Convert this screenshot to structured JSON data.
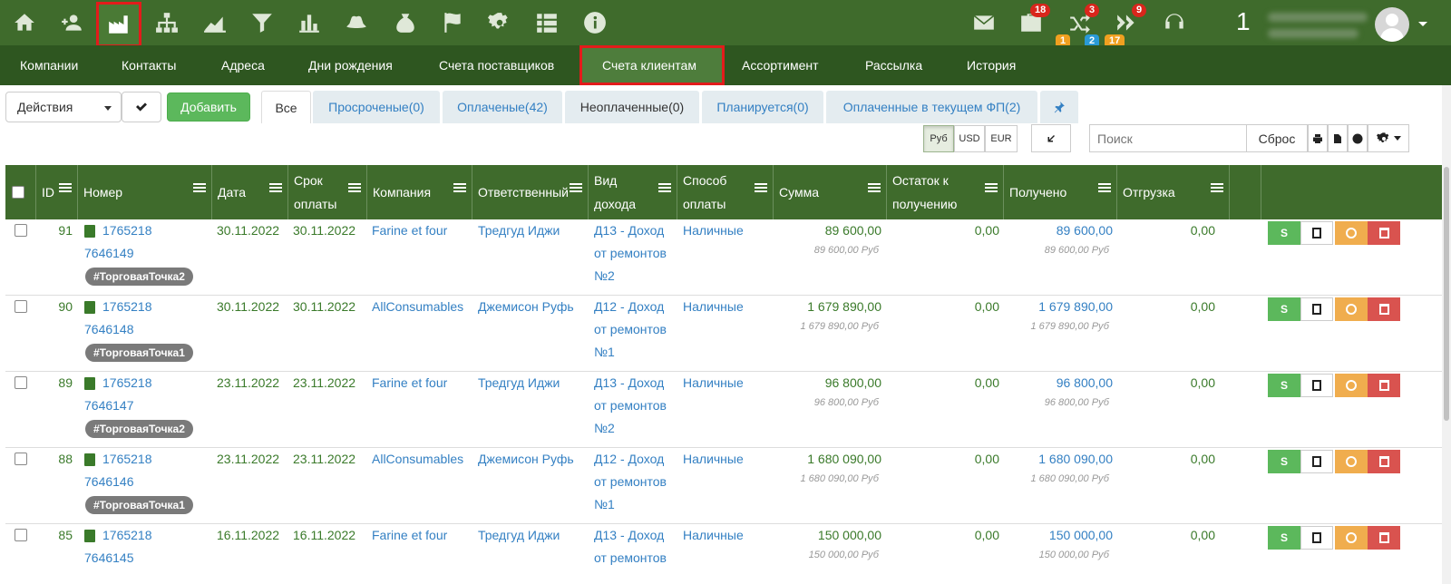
{
  "topbar": {
    "icons": [
      "home-icon",
      "contacts-icon",
      "factory-icon",
      "sitemap-icon",
      "area-chart-icon",
      "filter-icon",
      "bar-chart-icon",
      "hat-icon",
      "money-bag-icon",
      "flag-icon",
      "gear-icon",
      "list-icon",
      "info-icon"
    ],
    "mail_icon": "mail-icon",
    "briefcase_badge": "18",
    "shuffle_badge": "3",
    "shuffle_badge_orange": "1",
    "shuffle_badge_blue": "2",
    "forward_badge": "9",
    "forward_badge_orange": "17",
    "user_count": "1"
  },
  "nav": {
    "items": [
      "Компании",
      "Контакты",
      "Адреса",
      "Дни рождения",
      "Счета поставщиков",
      "Счета клиентам",
      "Ассортимент",
      "Рассылка",
      "История"
    ],
    "active": "Счета клиентам"
  },
  "toolbar": {
    "actions_label": "Действия",
    "add_label": "Добавить",
    "tabs": [
      "Все",
      "Просроченые(0)",
      "Оплаченые(42)",
      "Неоплаченные(0)",
      "Планируется(0)",
      "Оплаченные в текущем ФП(2)"
    ],
    "currencies": [
      "Руб",
      "USD",
      "EUR"
    ],
    "search_placeholder": "Поиск",
    "reset_label": "Сброс"
  },
  "table": {
    "headers": [
      "ID",
      "Номер",
      "Дата",
      "Срок оплаты",
      "Компания",
      "Ответственный",
      "Вид дохода",
      "Способ оплаты",
      "Сумма",
      "Остаток к получению",
      "Получено",
      "Отгрузка"
    ],
    "rows": [
      {
        "id": "91",
        "num1": "1765218",
        "num2": "7646149",
        "tag": "#ТорговаяТочка2",
        "date": "30.11.2022",
        "due": "30.11.2022",
        "company": "Farine et four",
        "resp": "Тредгуд Иджи",
        "income1": "Д13 - Доход",
        "income2": "от ремонтов",
        "income3": "№2",
        "pay": "Наличные",
        "sum": "89 600,00",
        "sum_sub": "89 600,00 Руб",
        "rest": "0,00",
        "got": "89 600,00",
        "got_sub": "89 600,00 Руб",
        "ship": "0,00"
      },
      {
        "id": "90",
        "num1": "1765218",
        "num2": "7646148",
        "tag": "#ТорговаяТочка1",
        "date": "30.11.2022",
        "due": "30.11.2022",
        "company": "AllConsumables",
        "resp": "Джемисон Руфь",
        "income1": "Д12 - Доход",
        "income2": "от ремонтов",
        "income3": "№1",
        "pay": "Наличные",
        "sum": "1 679 890,00",
        "sum_sub": "1 679 890,00 Руб",
        "rest": "0,00",
        "got": "1 679 890,00",
        "got_sub": "1 679 890,00 Руб",
        "ship": "0,00"
      },
      {
        "id": "89",
        "num1": "1765218",
        "num2": "7646147",
        "tag": "#ТорговаяТочка2",
        "date": "23.11.2022",
        "due": "23.11.2022",
        "company": "Farine et four",
        "resp": "Тредгуд Иджи",
        "income1": "Д13 - Доход",
        "income2": "от ремонтов",
        "income3": "№2",
        "pay": "Наличные",
        "sum": "96 800,00",
        "sum_sub": "96 800,00 Руб",
        "rest": "0,00",
        "got": "96 800,00",
        "got_sub": "96 800,00 Руб",
        "ship": "0,00"
      },
      {
        "id": "88",
        "num1": "1765218",
        "num2": "7646146",
        "tag": "#ТорговаяТочка1",
        "date": "23.11.2022",
        "due": "23.11.2022",
        "company": "AllConsumables",
        "resp": "Джемисон Руфь",
        "income1": "Д12 - Доход",
        "income2": "от ремонтов",
        "income3": "№1",
        "pay": "Наличные",
        "sum": "1 680 090,00",
        "sum_sub": "1 680 090,00 Руб",
        "rest": "0,00",
        "got": "1 680 090,00",
        "got_sub": "1 680 090,00 Руб",
        "ship": "0,00"
      },
      {
        "id": "85",
        "num1": "1765218",
        "num2": "7646145",
        "tag": "",
        "date": "16.11.2022",
        "due": "16.11.2022",
        "company": "Farine et four",
        "resp": "Тредгуд Иджи",
        "income1": "Д13 - Доход",
        "income2": "от ремонтов",
        "income3": "",
        "pay": "Наличные",
        "sum": "150 000,00",
        "sum_sub": "150 000,00 Руб",
        "rest": "0,00",
        "got": "150 000,00",
        "got_sub": "150 000,00 Руб",
        "ship": "0,00"
      }
    ],
    "action_labels": {
      "pay": "S"
    }
  }
}
